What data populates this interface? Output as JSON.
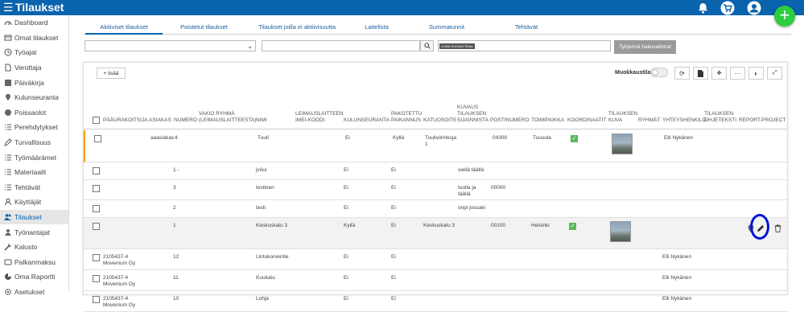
{
  "header": {
    "title": "Tilaukset",
    "menu_glyph": "☰"
  },
  "fab": {
    "label": "+"
  },
  "sidebar": {
    "items": [
      {
        "label": "Dashboard",
        "icon": "dashboard-icon"
      },
      {
        "label": "Omat tilaukset",
        "icon": "orders-icon"
      },
      {
        "label": "Työajat",
        "icon": "clock-icon"
      },
      {
        "label": "Verottaja",
        "icon": "tax-icon"
      },
      {
        "label": "Päiväkirja",
        "icon": "diary-icon"
      },
      {
        "label": "Kulunseuranta",
        "icon": "location-icon"
      },
      {
        "label": "Poissaolot",
        "icon": "absence-icon"
      },
      {
        "label": "Perehdytykset",
        "icon": "list-icon"
      },
      {
        "label": "Turvallisuus",
        "icon": "pencil-icon"
      },
      {
        "label": "Työmäärämet",
        "icon": "list-icon"
      },
      {
        "label": "Materiaalit",
        "icon": "list-icon"
      },
      {
        "label": "Tehtävät",
        "icon": "list-icon"
      },
      {
        "label": "Käyttäjät",
        "icon": "users-icon"
      },
      {
        "label": "Tilaukset",
        "icon": "customers-icon",
        "active": true
      },
      {
        "label": "Työnantajat",
        "icon": "employer-icon"
      },
      {
        "label": "Kalusto",
        "icon": "tools-icon"
      },
      {
        "label": "Palkanmaksu",
        "icon": "payroll-icon"
      },
      {
        "label": "Oma Raportti",
        "icon": "report-icon"
      },
      {
        "label": "Asetukset",
        "icon": "gear-icon"
      }
    ]
  },
  "tabs": [
    "Aktiiviset tilaukset",
    "Poistetut tilaukset",
    "Tilaukset joilla ei aktiivisuutta",
    "Laitelista",
    "Summatunnit",
    "Tehtävät"
  ],
  "filters": {
    "select_value": "",
    "search_value": "",
    "tag": "LISÄÄ SUODATTIMIA",
    "clear_label": "Tyhjennä hakuvalinnat"
  },
  "toolbar": {
    "add_label": "+ lisää",
    "edit_mode_label": "Muokkaustila"
  },
  "columns": [
    "Pääurakoitsija",
    "Asiakas",
    "Numero",
    "Vakio ryhmä (leimauslaitteesta)",
    "Nimi",
    "Leimauslaitteen IMEI-koodi",
    "Kulunseuranta",
    "Pakotettu paikannus",
    "Katuosoite",
    "Kuvaus tilauksen sijainnista",
    "Postinumero",
    "Toimipaikka",
    "Koordinaatit",
    "Tilauksen kuva",
    "Ryhmät",
    "Yhteyshenkilö",
    "Tilauksen ohjeteksti",
    "Report.project"
  ],
  "rows": [
    {
      "paaurakoitsija": "",
      "asiakas": "aaasiakas",
      "numero": "4",
      "nimi": "Tuuli",
      "kulunseuranta": "Ei",
      "pakotettu": "Kyllä",
      "katuosoite": "Tuuliviirinkuja 1",
      "kuvaus": "",
      "postinumero": "04300",
      "toimipaikka": "Tuusula",
      "koordinaatit": true,
      "kuva": true,
      "yhteyshenkilo": "Elli Nykänen"
    },
    {
      "paaurakoitsija": "",
      "asiakas": "",
      "numero": "1 -",
      "nimi": "jvöui",
      "kulunseuranta": "Ei",
      "pakotettu": "Ei",
      "katuosoite": "",
      "kuvaus": "siellä täällä",
      "postinumero": "",
      "toimipaikka": "",
      "koordinaatit": false,
      "kuva": false,
      "yhteyshenkilo": ""
    },
    {
      "paaurakoitsija": "",
      "asiakas": "",
      "numero": "3",
      "nimi": "testinen",
      "kulunseuranta": "Ei",
      "pakotettu": "Ei",
      "katuosoite": "",
      "kuvaus": "tuolla ja täällä",
      "postinumero": "00000",
      "toimipaikka": "",
      "koordinaatit": false,
      "kuva": false,
      "yhteyshenkilo": ""
    },
    {
      "paaurakoitsija": "",
      "asiakas": "",
      "numero": "2",
      "nimi": "testi",
      "kulunseuranta": "Ei",
      "pakotettu": "Ei",
      "katuosoite": "",
      "kuvaus": "onpi jossaki",
      "postinumero": "",
      "toimipaikka": "",
      "koordinaatit": false,
      "kuva": false,
      "yhteyshenkilo": ""
    },
    {
      "paaurakoitsija": "",
      "asiakas": "",
      "numero": "1",
      "nimi": "Keskuskatu 3",
      "kulunseuranta": "Kyllä",
      "pakotettu": "Ei",
      "katuosoite": "Keskuskatu 3",
      "kuvaus": "",
      "postinumero": "00100",
      "toimipaikka": "Helsinki",
      "koordinaatit": true,
      "kuva": true,
      "yhteyshenkilo": ""
    },
    {
      "paaurakoitsija": "2105437-4 Movenium Oy",
      "asiakas": "",
      "numero": "12",
      "nimi": "Lintukorventie",
      "kulunseuranta": "Ei",
      "pakotettu": "Ei",
      "katuosoite": "",
      "kuvaus": "",
      "postinumero": "",
      "toimipaikka": "",
      "koordinaatit": false,
      "kuva": false,
      "yhteyshenkilo": "Elli Nykänen"
    },
    {
      "paaurakoitsija": "2105437-4 Movenium Oy",
      "asiakas": "",
      "numero": "11",
      "nimi": "Kuukatu",
      "kulunseuranta": "Ei",
      "pakotettu": "Ei",
      "katuosoite": "",
      "kuvaus": "",
      "postinumero": "",
      "toimipaikka": "",
      "koordinaatit": false,
      "kuva": false,
      "yhteyshenkilo": "Elli Nykänen"
    },
    {
      "paaurakoitsija": "2105437-4 Movenium Oy",
      "asiakas": "",
      "numero": "10",
      "nimi": "Lohja",
      "kulunseuranta": "Ei",
      "pakotettu": "Ei",
      "katuosoite": "",
      "kuvaus": "",
      "postinumero": "",
      "toimipaikka": "",
      "koordinaatit": false,
      "kuva": false,
      "yhteyshenkilo": "Elli Nykänen"
    }
  ],
  "colors": {
    "primary": "#0a63ad",
    "fab": "#2ecc40",
    "highlight": "#f39c12",
    "check": "#5cb85c",
    "annotation": "#0015d6"
  }
}
